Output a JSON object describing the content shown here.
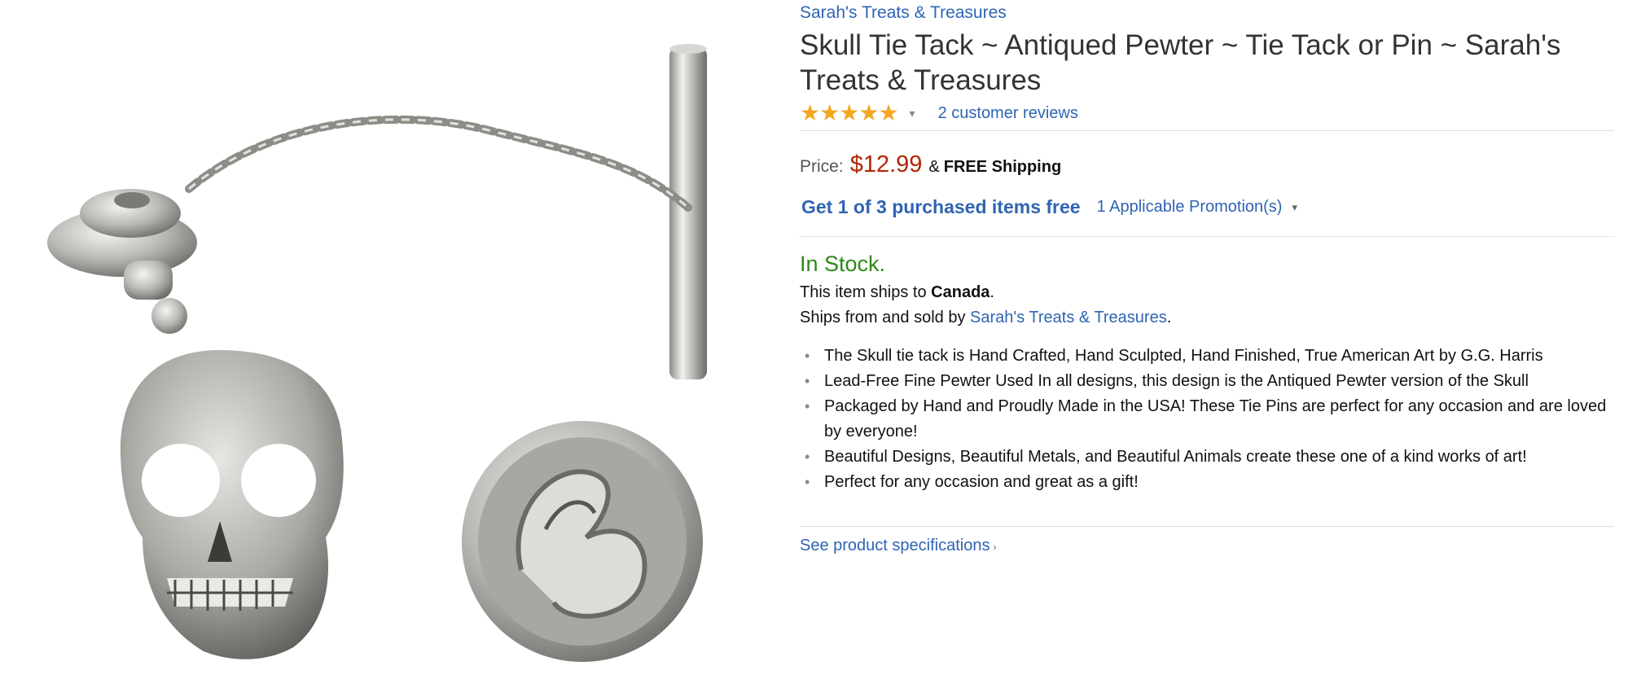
{
  "product": {
    "brand": "Sarah's Treats & Treasures",
    "title": "Skull Tie Tack ~ Antiqued Pewter ~ Tie Tack or Pin ~ Sarah's Treats & Treasures",
    "rating": 5,
    "rating_max": 5,
    "reviews_link": "2 customer reviews"
  },
  "price": {
    "label": "Price:",
    "value": "$12.99",
    "amp": "&",
    "shipping": "FREE Shipping"
  },
  "promotion": {
    "headline": "Get 1 of 3 purchased items free",
    "link": "1 Applicable Promotion(s)"
  },
  "availability": {
    "stock": "In Stock.",
    "ship_to_prefix": "This item ships to ",
    "ship_to_country": "Canada",
    "ship_to_suffix": ".",
    "sold_by_prefix": "Ships from and sold by ",
    "sold_by_name": "Sarah's Treats & Treasures",
    "sold_by_suffix": "."
  },
  "bullets": [
    "The Skull tie tack is Hand Crafted, Hand Sculpted, Hand Finished, True American Art by G.G. Harris",
    "Lead-Free Fine Pewter Used In all designs, this design is the Antiqued Pewter version of the Skull",
    "Packaged by Hand and Proudly Made in the USA! These Tie Pins are perfect for any occasion and are loved by everyone!",
    "Beautiful Designs, Beautiful Metals, and Beautiful Animals create these one of a kind works of art!",
    "Perfect for any occasion and great as a gift!"
  ],
  "specs_link": "See product specifications",
  "colors": {
    "link": "#2f64b3",
    "price": "#b12704",
    "stock": "#2c8a19",
    "star": "#f5a623"
  },
  "icons": {
    "bullet": "•",
    "star": "★",
    "caret_down": "▾",
    "caret_right": "›"
  }
}
